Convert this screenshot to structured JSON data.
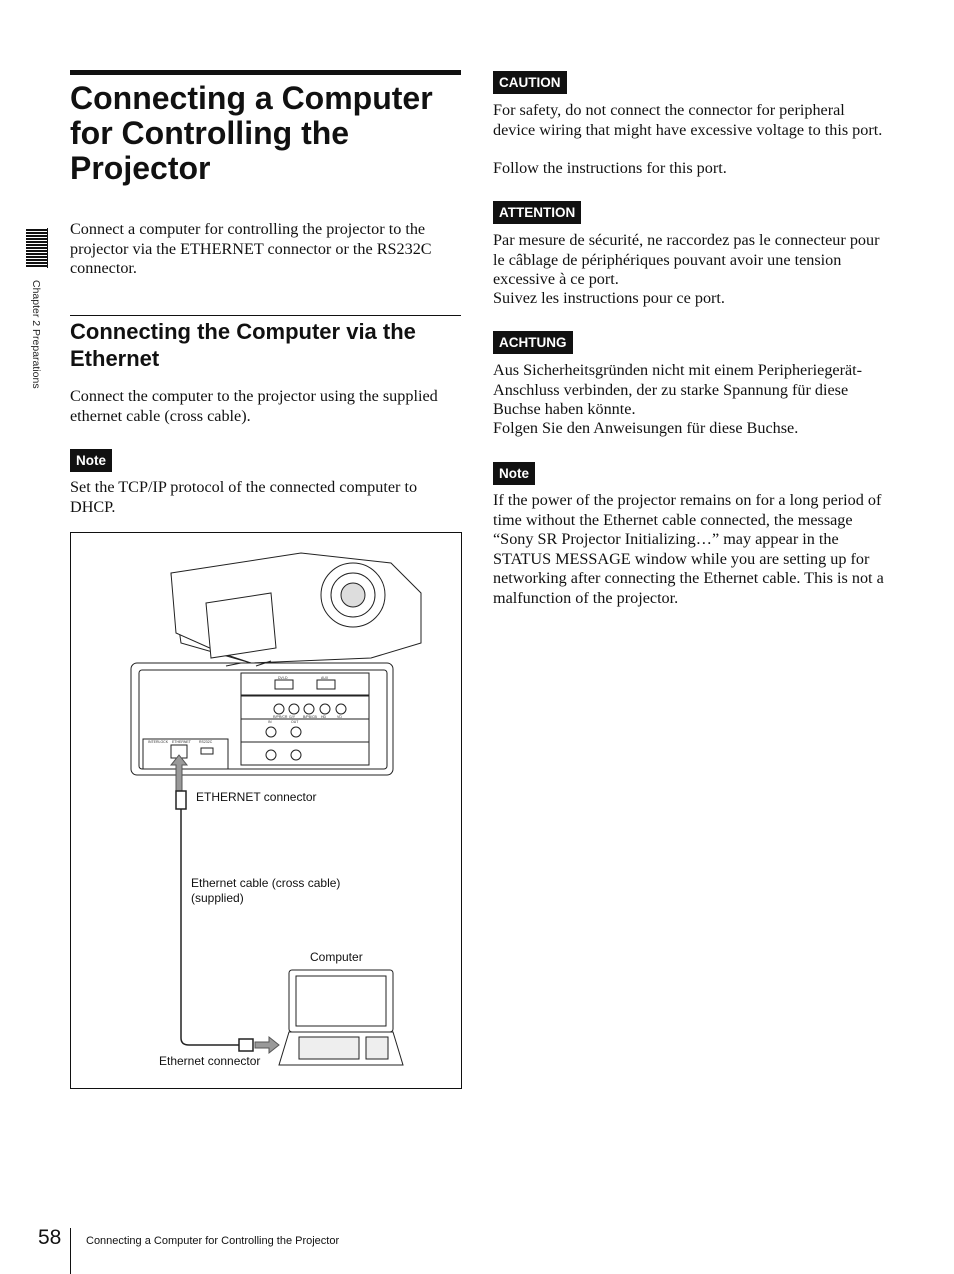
{
  "title": "Connecting a Computer for Controlling the Projector",
  "intro": "Connect a computer for controlling the projector to the projector via the ETHERNET connector or the RS232C connector.",
  "section": {
    "heading": "Connecting the Computer via the Ethernet",
    "body": "Connect the computer to the projector using the supplied ethernet cable (cross cable).",
    "note_label": "Note",
    "note": "Set the TCP/IP protocol of the connected computer to DHCP."
  },
  "diagram": {
    "ethernet_connector_label": "ETHERNET connector",
    "cable_label_line1": "Ethernet cable (cross cable)",
    "cable_label_line2": "(supplied)",
    "computer_label": "Computer",
    "pc_connector_label": "Ethernet connector",
    "panel_labels": {
      "dvid": "DVI-D",
      "aux": "AUX",
      "r": "R/PR/CR",
      "g": "G/Y",
      "b": "B/PB/CB",
      "hd": "HD",
      "vd": "VD",
      "in": "IN",
      "out": "OUT",
      "interlock": "INTERLOCK",
      "ethernet": "ETHERNET",
      "rs232c": "RS232C"
    }
  },
  "warnings": [
    {
      "label": "CAUTION",
      "lines": [
        "For safety, do not connect the connector for peripheral device wiring that might have excessive voltage to this port.",
        "Follow the instructions for this port."
      ]
    },
    {
      "label": "ATTENTION",
      "lines": [
        "Par mesure de sécurité, ne raccordez pas le connecteur pour le câblage de périphériques pouvant avoir une tension excessive à ce port.",
        "Suivez les instructions pour ce port."
      ]
    },
    {
      "label": "ACHTUNG",
      "lines": [
        "Aus Sicherheitsgründen nicht mit einem Peripheriegerät-Anschluss verbinden, der zu starke Spannung für diese Buchse haben könnte.",
        "Folgen Sie den Anweisungen für diese Buchse."
      ]
    }
  ],
  "note2": {
    "label": "Note",
    "text": "If the power of the projector remains on for a long period of time without the Ethernet cable connected, the message “Sony SR Projector Initializing…” may appear in the STATUS MESSAGE window while you are setting up for networking after connecting the Ethernet cable. This is not a malfunction of the projector."
  },
  "sidebar": {
    "chapter": "Chapter 2  Preparations"
  },
  "footer": {
    "page_number": "58",
    "running_title": "Connecting a Computer for Controlling the Projector"
  }
}
